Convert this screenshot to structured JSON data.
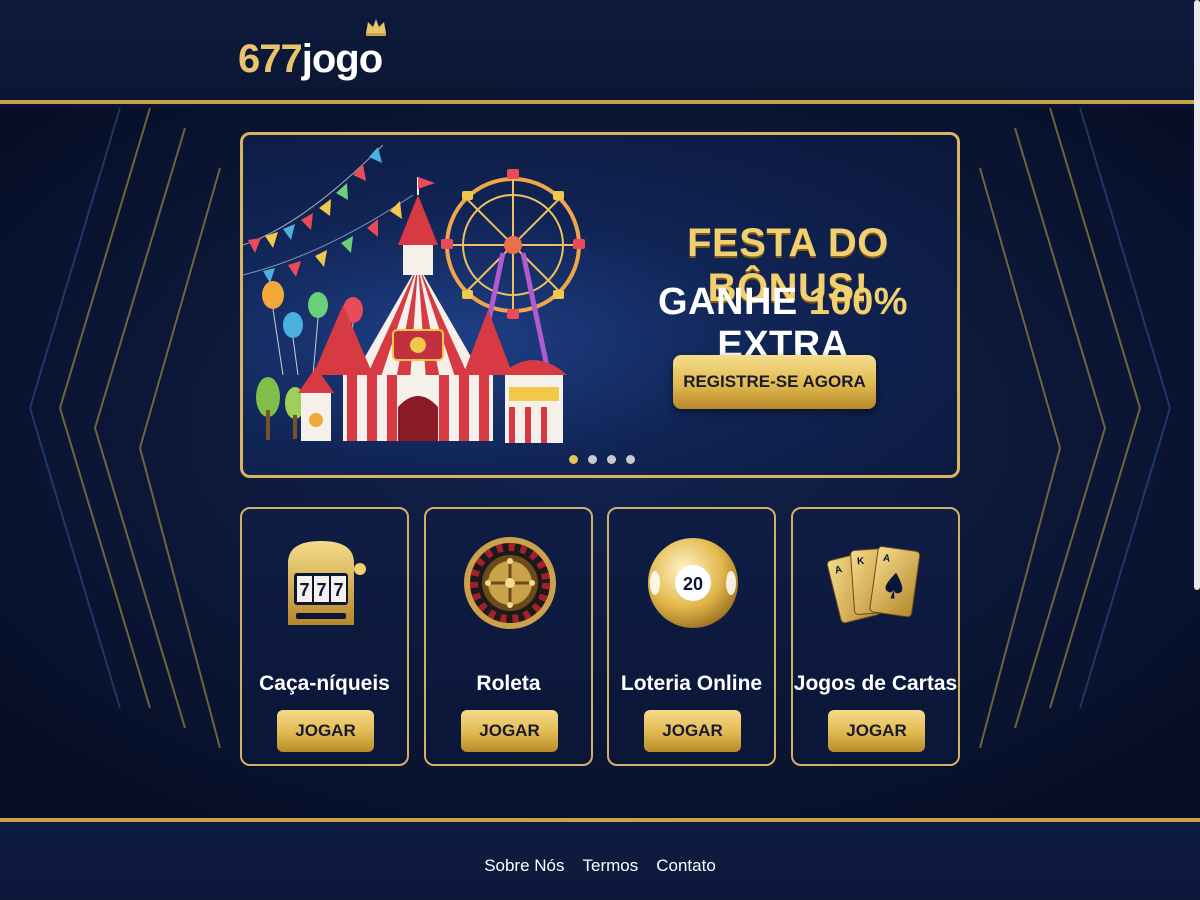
{
  "header": {
    "logo_number": "677",
    "logo_word": "jogo"
  },
  "banner": {
    "title": "FESTA DO BÔNUS!",
    "subtitle_pre": "GANHE ",
    "subtitle_highlight": "100%",
    "subtitle_post": " EXTRA",
    "cta_label": "REGISTRE-SE AGORA",
    "slides": 4,
    "active_slide": 1
  },
  "cards": [
    {
      "title": "Caça-níqueis",
      "button": "JOGAR",
      "icon": "slot-machine-icon",
      "reel": "777"
    },
    {
      "title": "Roleta",
      "button": "JOGAR",
      "icon": "roulette-icon"
    },
    {
      "title": "Loteria Online",
      "button": "JOGAR",
      "icon": "lottery-ball-icon",
      "ball_number": "20"
    },
    {
      "title": "Jogos de Cartas",
      "button": "JOGAR",
      "icon": "playing-cards-icon"
    }
  ],
  "footer": {
    "links": [
      "Sobre Nós",
      "Termos",
      "Contato"
    ]
  },
  "colors": {
    "gold": "#d8b45e",
    "navy": "#0b1637",
    "highlight": "#f2cf6f"
  }
}
